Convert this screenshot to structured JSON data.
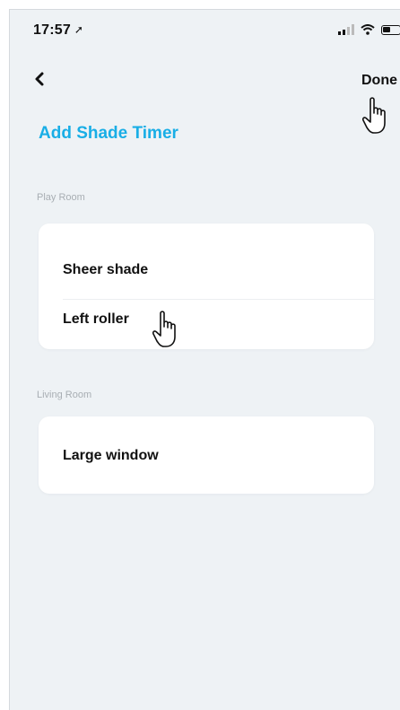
{
  "status_bar": {
    "time": "17:57",
    "icons": [
      "location-arrow-icon",
      "signal-icon",
      "wifi-icon",
      "battery-icon"
    ]
  },
  "nav": {
    "back_icon": "chevron-left-icon",
    "done_label": "Done"
  },
  "page_title": "Add Shade Timer",
  "rooms": [
    {
      "name": "Play Room",
      "shades": [
        {
          "label": "Sheer shade"
        },
        {
          "label": "Left roller"
        }
      ]
    },
    {
      "name": "Living Room",
      "shades": [
        {
          "label": "Large window"
        }
      ]
    }
  ],
  "colors": {
    "accent": "#19aee6",
    "background": "#eef2f5",
    "card": "#ffffff",
    "text": "#111111"
  }
}
